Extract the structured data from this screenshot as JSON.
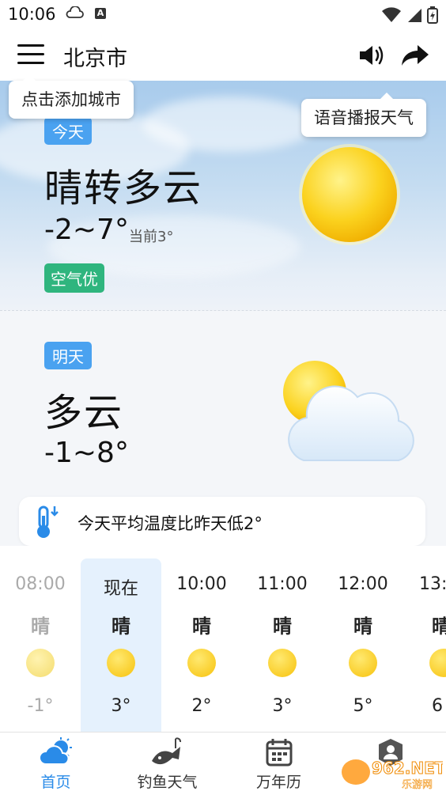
{
  "status_bar": {
    "time": "10:06",
    "a_icon": "A"
  },
  "header": {
    "city": "北京市",
    "speaker_icon": "speaker-icon",
    "share_icon": "share-icon"
  },
  "tooltips": {
    "add_city": "点击添加城市",
    "voice_report": "语音播报天气"
  },
  "today": {
    "badge": "今天",
    "condition": "晴转多云",
    "temp_range": "-2~7°",
    "current": "当前3°",
    "aqi": "空气优",
    "icon": "sun-icon"
  },
  "tomorrow": {
    "badge": "明天",
    "condition": "多云",
    "temp_range": "-1~8°",
    "icon": "partly-cloudy-icon"
  },
  "notice": {
    "text": "今天平均温度比昨天低2°",
    "icon": "thermometer-icon"
  },
  "hourly": [
    {
      "time": "08:00",
      "cond": "晴",
      "temp": "-1°",
      "state": "past"
    },
    {
      "time": "现在",
      "cond": "晴",
      "temp": "3°",
      "state": "now"
    },
    {
      "time": "10:00",
      "cond": "晴",
      "temp": "2°",
      "state": "future"
    },
    {
      "time": "11:00",
      "cond": "晴",
      "temp": "3°",
      "state": "future"
    },
    {
      "time": "12:00",
      "cond": "晴",
      "temp": "5°",
      "state": "future"
    },
    {
      "time": "13:",
      "cond": "晴",
      "temp": "6",
      "state": "future"
    }
  ],
  "nav": [
    {
      "label": "首页",
      "icon": "weather-home-icon",
      "active": true
    },
    {
      "label": "钓鱼天气",
      "icon": "fish-icon",
      "active": false
    },
    {
      "label": "万年历",
      "icon": "calendar-icon",
      "active": false
    },
    {
      "label": "",
      "icon": "profile-icon",
      "active": false
    }
  ],
  "watermark": {
    "brand": "962.NET",
    "sub": "乐游网"
  },
  "colors": {
    "accent": "#2a8be8",
    "badge_blue": "#4aa2f0",
    "aqi_green": "#2fb57e",
    "sun": "#f7c20c"
  }
}
